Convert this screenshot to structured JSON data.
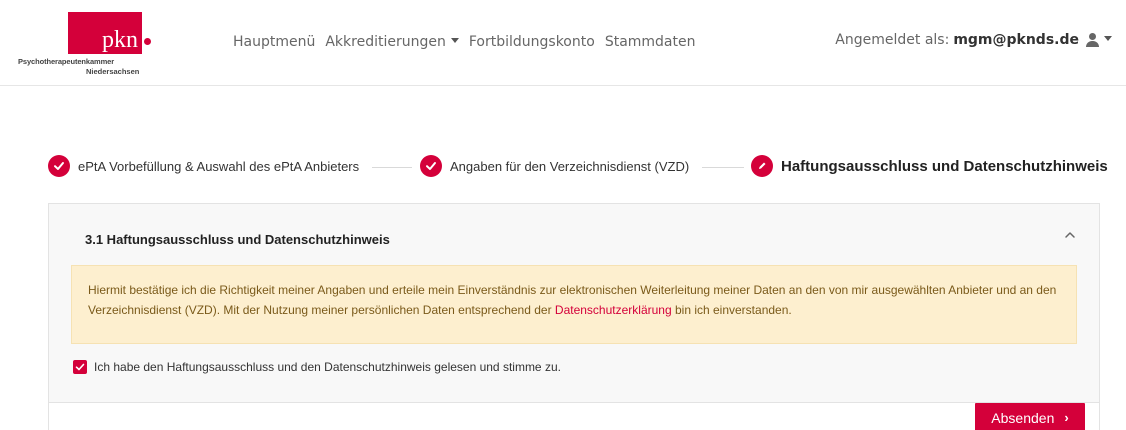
{
  "logo": {
    "mark": "pkn",
    "line1": "Psychotherapeutenkammer",
    "line2": "Niedersachsen"
  },
  "nav": {
    "items": [
      {
        "label": "Hauptmenü"
      },
      {
        "label": "Akkreditierungen"
      },
      {
        "label": "Fortbildungskonto"
      },
      {
        "label": "Stammdaten"
      }
    ]
  },
  "user": {
    "prefix": "Angemeldet als:",
    "email": "mgm@pknds.de"
  },
  "stepper": {
    "steps": [
      {
        "label": "ePtA Vorbefüllung & Auswahl des ePtA Anbieters",
        "state": "done"
      },
      {
        "label": "Angaben für den Verzeichnisdienst (VZD)",
        "state": "done"
      },
      {
        "label": "Haftungsausschluss und Datenschutzhinweis",
        "state": "active"
      }
    ]
  },
  "section": {
    "title": "3.1 Haftungsausschluss und Datenschutzhinweis",
    "alert_text_1": "Hiermit bestätige ich die Richtigkeit meiner Angaben und erteile mein Einverständnis zur elektronischen Weiterleitung meiner Daten an den von mir ausgewählten Anbieter und an den Verzeichnisdienst (VZD). Mit der Nutzung meiner persönlichen Daten entsprechend der ",
    "alert_link": "Datenschutzerklärung",
    "alert_text_2": " bin ich einverstanden.",
    "checkbox_label": "Ich habe den Haftungsausschluss und den Datenschutzhinweis gelesen und stimme zu.",
    "checkbox_checked": true
  },
  "footer": {
    "submit_label": "Absenden"
  },
  "colors": {
    "brand": "#d4003a",
    "alert_bg": "#fdefcf",
    "alert_text": "#7a5a1a"
  }
}
